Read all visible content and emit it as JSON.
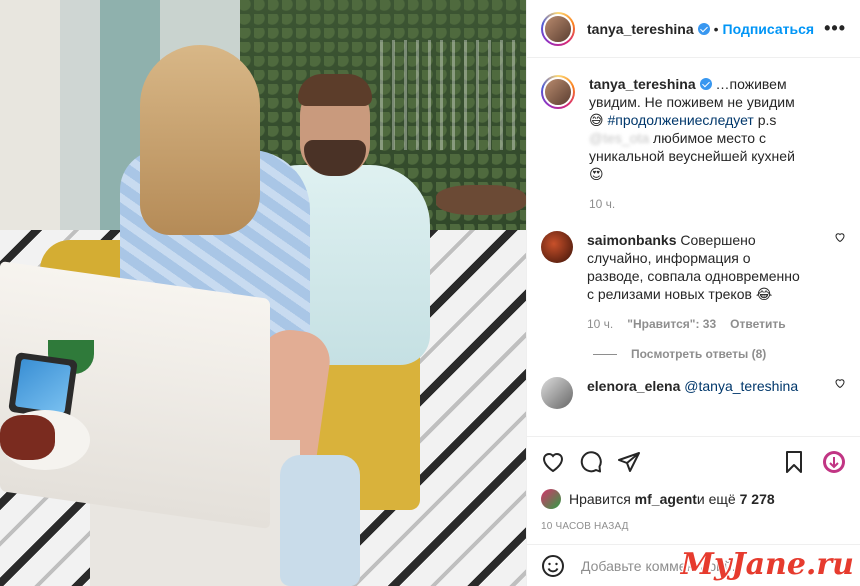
{
  "post": {
    "username": "tanya_tereshina",
    "follow_label": "Подписаться",
    "more_label": "•••"
  },
  "caption": {
    "username": "tanya_tereshina",
    "text_1": "…поживем увидим. Не поживем не увидим 😅 ",
    "hashtag": "#продолжениеследует",
    "text_2": " p.s ",
    "blurred": "@tes_ota",
    "text_3": " любимое место с уникальной веуснейшей кухней😍",
    "time": "10 ч."
  },
  "comments": [
    {
      "username": "saimonbanks",
      "text": "Совершено случайно, информация о разводе, совпала одновременно с релизами новых треков 😂",
      "time": "10 ч.",
      "likes": "\"Нравится\": 33",
      "reply_label": "Ответить",
      "view_replies": "Посмотреть ответы (8)"
    },
    {
      "username": "elenora_elena",
      "mention": "@tanya_tereshina"
    }
  ],
  "likes": {
    "prefix": "Нравится ",
    "user": "mf_agent",
    "middle": " и ещё ",
    "count": "7 278"
  },
  "time_ago": "10 часов назад",
  "comment_input": {
    "placeholder": "Добавьте комментарий..."
  },
  "watermark": "MyJane.ru",
  "icons": {
    "like": "heart-icon",
    "comment": "comment-icon",
    "share": "share-icon",
    "save": "bookmark-icon",
    "emoji": "emoji-icon"
  }
}
